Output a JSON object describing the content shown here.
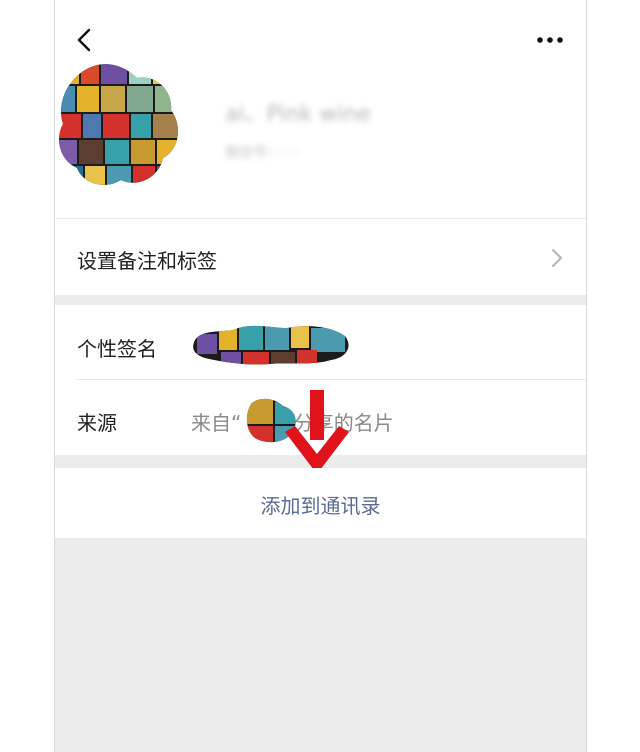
{
  "header": {
    "back_icon": "chevron-left-icon",
    "more_icon": "more-dots-icon"
  },
  "profile": {
    "nickname": "ai、Pink wine",
    "wechat_id": "微信号：······"
  },
  "remark_row": {
    "label": "设置备注和标签",
    "icon": "chevron-right-icon"
  },
  "signature_row": {
    "label": "个性签名"
  },
  "source_row": {
    "label": "来源",
    "value_prefix": "来自“",
    "value_suffix": "”分享的名片"
  },
  "add_contact": {
    "label": "添加到通讯录"
  },
  "colors": {
    "accent": "#5b6b96",
    "annotation_arrow": "#e0121a",
    "divider": "#ececec"
  }
}
